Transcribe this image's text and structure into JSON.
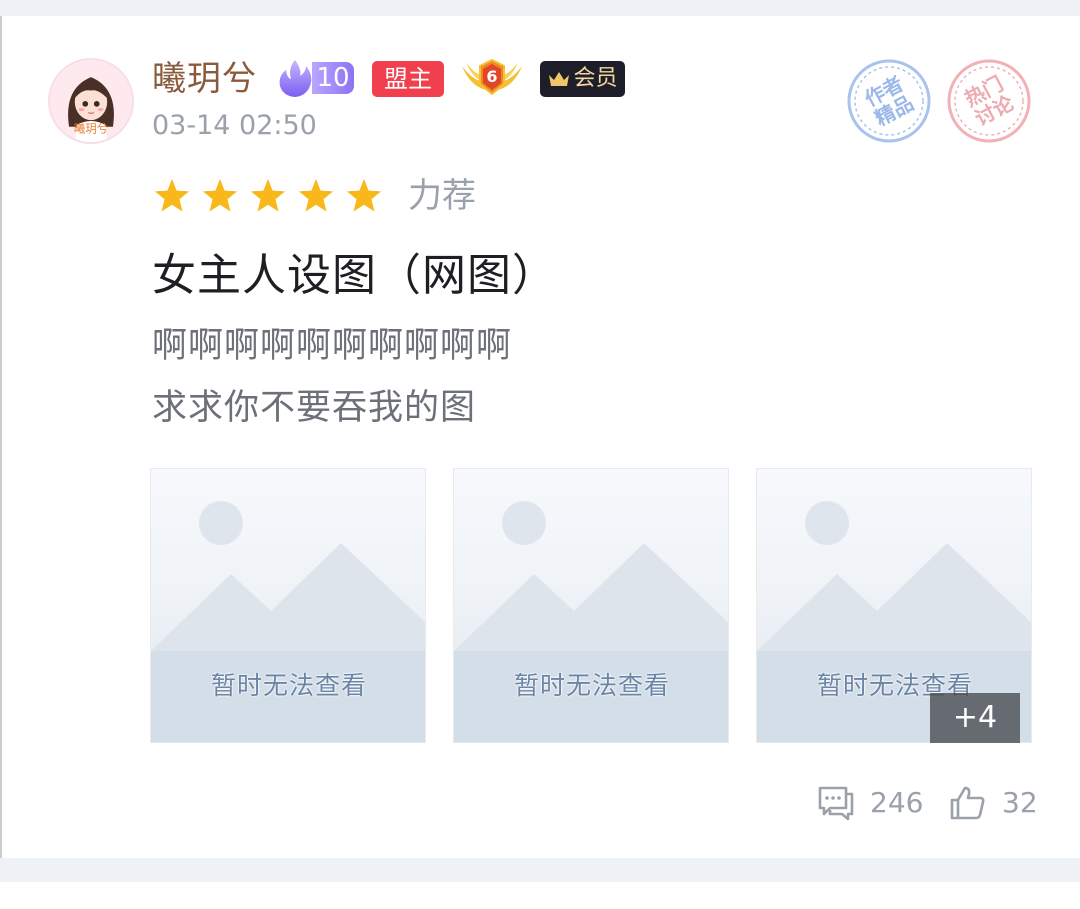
{
  "post": {
    "author": {
      "name": "曦玥兮",
      "avatar_text": "曦玥兮",
      "level": "10",
      "role_badge": "盟主",
      "rank_number": "6",
      "vip_label": "会员"
    },
    "timestamp": "03-14 02:50",
    "stamps": {
      "blue": "作者\n精品",
      "red": "热门\n讨论"
    },
    "rating": {
      "stars": 5,
      "max_stars": 5,
      "label": "力荐"
    },
    "title": "女主人设图（网图）",
    "body_lines": [
      "啊啊啊啊啊啊啊啊啊啊",
      "求求你不要吞我的图"
    ],
    "images": [
      {
        "caption": "暂时无法查看"
      },
      {
        "caption": "暂时无法查看"
      },
      {
        "caption": "暂时无法查看"
      }
    ],
    "more_images": "+4",
    "comments": "246",
    "likes": "32"
  },
  "colors": {
    "author_name": "#8a5a3c",
    "star": "#f8b81a",
    "role_badge": "#f0404d",
    "level_badge": "#8b73f5",
    "vip_bg": "#1e1e2a"
  }
}
